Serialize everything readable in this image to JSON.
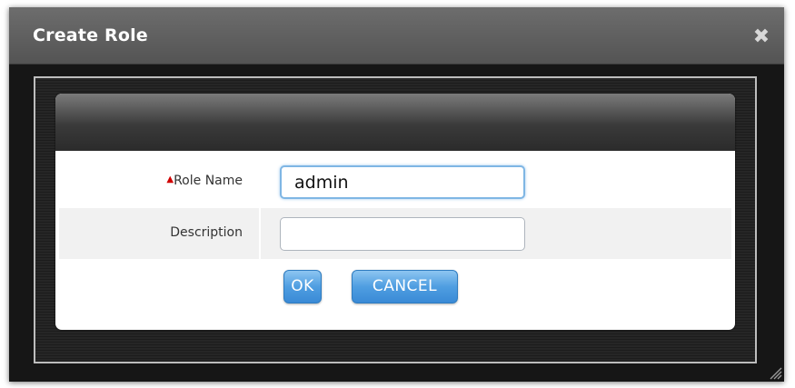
{
  "dialog": {
    "title": "Create Role",
    "close_icon": "close-icon",
    "resize_icon": "resize-grip-icon"
  },
  "form": {
    "role_name": {
      "label": "Role Name",
      "required_mark": "▲",
      "value": "admin"
    },
    "description": {
      "label": "Description",
      "value": ""
    }
  },
  "buttons": {
    "ok_label": "OK",
    "cancel_label": "CANCEL"
  },
  "colors": {
    "titlebar": "#5f5f5f",
    "button_blue": "#4f9ee1",
    "required_red": "#d00000",
    "focus_border": "#7fb6e4"
  }
}
